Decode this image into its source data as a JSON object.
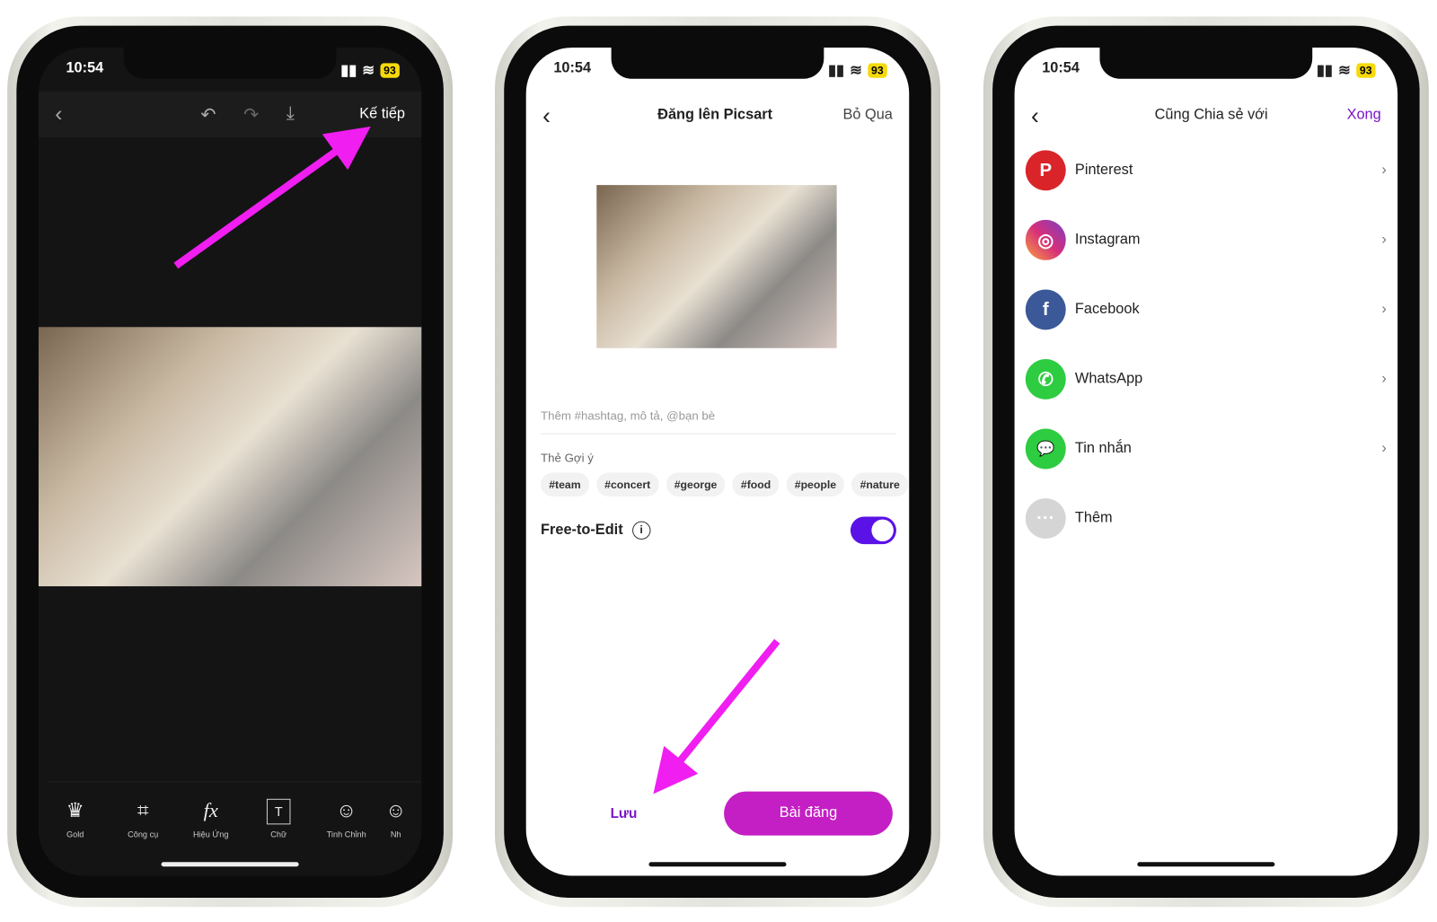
{
  "status": {
    "time": "10:54",
    "battery": "93"
  },
  "editor": {
    "next": "Kế tiếp",
    "tools": [
      {
        "label": "Gold",
        "icon": "crown-icon",
        "glyph": "♛"
      },
      {
        "label": "Công cụ",
        "icon": "crop-icon",
        "glyph": "⌗"
      },
      {
        "label": "Hiệu Ứng",
        "icon": "fx-icon",
        "glyph": "fx"
      },
      {
        "label": "Chữ",
        "icon": "text-icon",
        "glyph": "T"
      },
      {
        "label": "Tinh Chỉnh",
        "icon": "retouch-icon",
        "glyph": "☺"
      },
      {
        "label": "Nh",
        "icon": "sticker-icon",
        "glyph": "☺"
      }
    ]
  },
  "post": {
    "title": "Đăng lên Picsart",
    "skip": "Bỏ Qua",
    "placeholder": "Thêm #hashtag, mô tả, @bạn bè",
    "suggest_label": "Thẻ Gợi ý",
    "tags": [
      "#team",
      "#concert",
      "#george",
      "#food",
      "#people",
      "#nature"
    ],
    "free_to_edit": "Free-to-Edit",
    "free_to_edit_on": true,
    "save": "Lưu",
    "publish": "Bài đăng",
    "accent": "#c41fc4",
    "toggle_color": "#5a12e6"
  },
  "share": {
    "title": "Cũng Chia sẻ với",
    "done": "Xong",
    "items": [
      {
        "label": "Pinterest",
        "color": "#d9252a",
        "glyph": "P"
      },
      {
        "label": "Instagram",
        "color": "#d62f7a",
        "glyph": "◎"
      },
      {
        "label": "Facebook",
        "color": "#3b5998",
        "glyph": "f"
      },
      {
        "label": "WhatsApp",
        "color": "#2ecc40",
        "glyph": "✆"
      },
      {
        "label": "Tin nhắn",
        "color": "#2ecc40",
        "glyph": "💬"
      },
      {
        "label": "Thêm",
        "color": "#d5d5d5",
        "glyph": "···"
      }
    ]
  },
  "annotation_color": "#f01ef0"
}
